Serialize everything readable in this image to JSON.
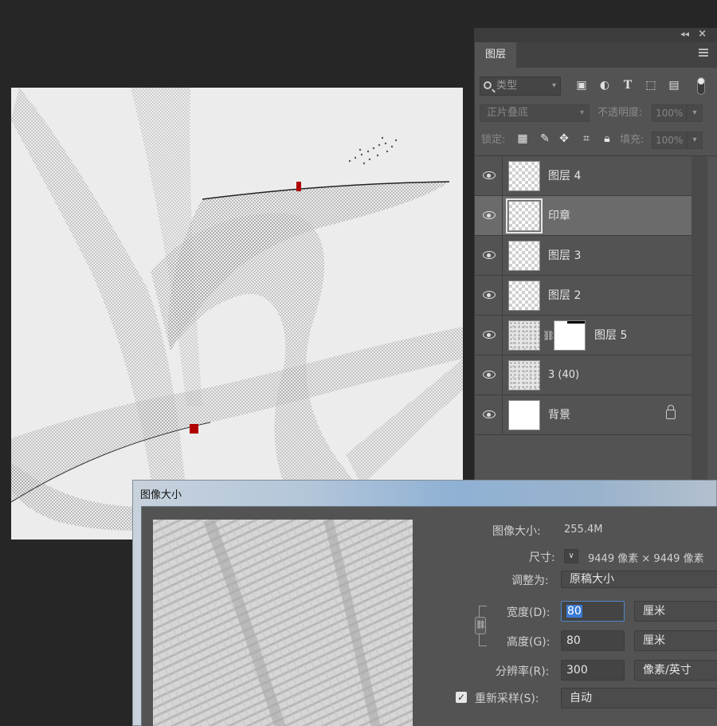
{
  "layers_panel": {
    "tab_label": "图层",
    "filter": {
      "placeholder": "类型"
    },
    "blend_mode": "正片叠底",
    "opacity_label": "不透明度:",
    "opacity_value": "100%",
    "lock_label": "锁定:",
    "fill_label": "填充:",
    "fill_value": "100%",
    "layers": [
      {
        "name": "图层 4",
        "thumb": "transparent",
        "visible": true,
        "selected": false
      },
      {
        "name": "印章",
        "thumb": "transparent",
        "visible": true,
        "selected": true
      },
      {
        "name": "图层 3",
        "thumb": "transparent",
        "visible": true,
        "selected": false
      },
      {
        "name": "图层 2",
        "thumb": "transparent",
        "visible": true,
        "selected": false
      },
      {
        "name": "图层 5",
        "thumb": "texture",
        "visible": true,
        "selected": false,
        "has_mask": true
      },
      {
        "name": "3 (40)",
        "thumb": "texture",
        "visible": true,
        "selected": false
      },
      {
        "name": "背景",
        "thumb": "white",
        "visible": true,
        "selected": false,
        "locked": true
      }
    ]
  },
  "dialog": {
    "title": "图像大小",
    "image_size_label": "图像大小:",
    "image_size_value": "255.4M",
    "dimensions_label": "尺寸:",
    "dimensions_value": "9449 像素 × 9449 像素",
    "fit_label": "调整为:",
    "fit_value": "原稿大小",
    "width_label": "宽度(D):",
    "width_value": "80",
    "width_unit": "厘米",
    "height_label": "高度(G):",
    "height_value": "80",
    "height_unit": "厘米",
    "resolution_label": "分辨率(R):",
    "resolution_value": "300",
    "resolution_unit": "像素/英寸",
    "resample_label": "重新采样(S):",
    "resample_checked": true,
    "resample_value": "自动"
  },
  "colors": {
    "app_bg": "#262626",
    "panel_bg": "#535353",
    "selected_layer": "#6b6b6b",
    "seal_red": "#b00000"
  }
}
